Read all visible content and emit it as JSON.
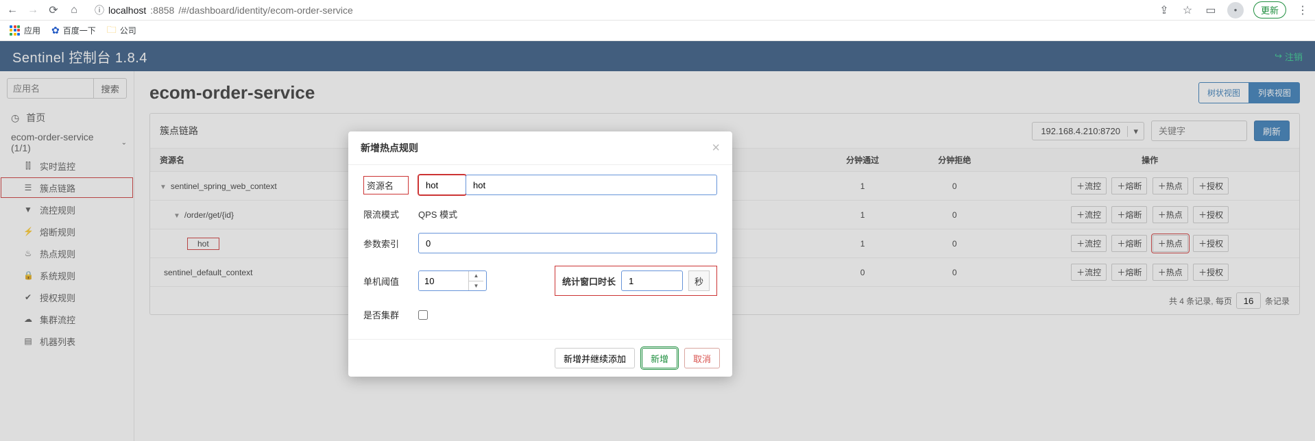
{
  "browser": {
    "url_host": "localhost",
    "url_port": ":8858",
    "url_path": "/#/dashboard/identity/ecom-order-service",
    "update_label": "更新",
    "bookmarks": {
      "apps": "应用",
      "baidu": "百度一下",
      "company": "公司"
    }
  },
  "navbar": {
    "brand": "Sentinel 控制台 1.8.4",
    "logout": "注销"
  },
  "sidebar": {
    "search_placeholder": "应用名",
    "search_btn": "搜索",
    "home": "首页",
    "app_item": "ecom-order-service (1/1)",
    "items": {
      "metrics": "实时监控",
      "cluster": "簇点链路",
      "flow": "流控规则",
      "degrade": "熔断规则",
      "param": "热点规则",
      "system": "系统规则",
      "auth": "授权规则",
      "cluster_flow": "集群流控",
      "machines": "机器列表"
    }
  },
  "main": {
    "title": "ecom-order-service",
    "view_tree": "树状视图",
    "view_list": "列表视图",
    "panel_title": "簇点链路",
    "ip_value": "192.168.4.210:8720",
    "kw_placeholder": "关键字",
    "refresh": "刷新",
    "columns": {
      "resource": "资源名",
      "pass": "分钟通过",
      "reject": "分钟拒绝",
      "ops": "操作"
    },
    "rows": [
      {
        "name": "sentinel_spring_web_context",
        "indent": 0,
        "toggle": "▼",
        "pass": "1",
        "reject": "0",
        "ops_marked": false
      },
      {
        "name": "/order/get/{id}",
        "indent": 1,
        "toggle": "▼",
        "pass": "1",
        "reject": "0",
        "ops_marked": false
      },
      {
        "name": "hot",
        "indent": 2,
        "toggle": "",
        "pass": "1",
        "reject": "0",
        "ops_marked": true
      },
      {
        "name": "sentinel_default_context",
        "indent": 0,
        "toggle": "",
        "pass": "0",
        "reject": "0",
        "ops_marked": false
      }
    ],
    "op_labels": {
      "flow": "流控",
      "degrade": "熔断",
      "hot": "热点",
      "auth": "授权"
    },
    "foot_prefix": "共 4 条记录, 每页",
    "foot_page": "16",
    "foot_suffix": "条记录"
  },
  "modal": {
    "title": "新增热点规则",
    "labels": {
      "resource": "资源名",
      "mode": "限流模式",
      "param_idx": "参数索引",
      "threshold": "单机阈值",
      "window": "统计窗口时长",
      "cluster": "是否集群"
    },
    "mode_value": "QPS 模式",
    "resource_value": "hot",
    "param_idx_value": "0",
    "threshold_value": "10",
    "window_value": "1",
    "window_unit": "秒",
    "buttons": {
      "add_continue": "新增并继续添加",
      "add": "新增",
      "cancel": "取消"
    }
  }
}
